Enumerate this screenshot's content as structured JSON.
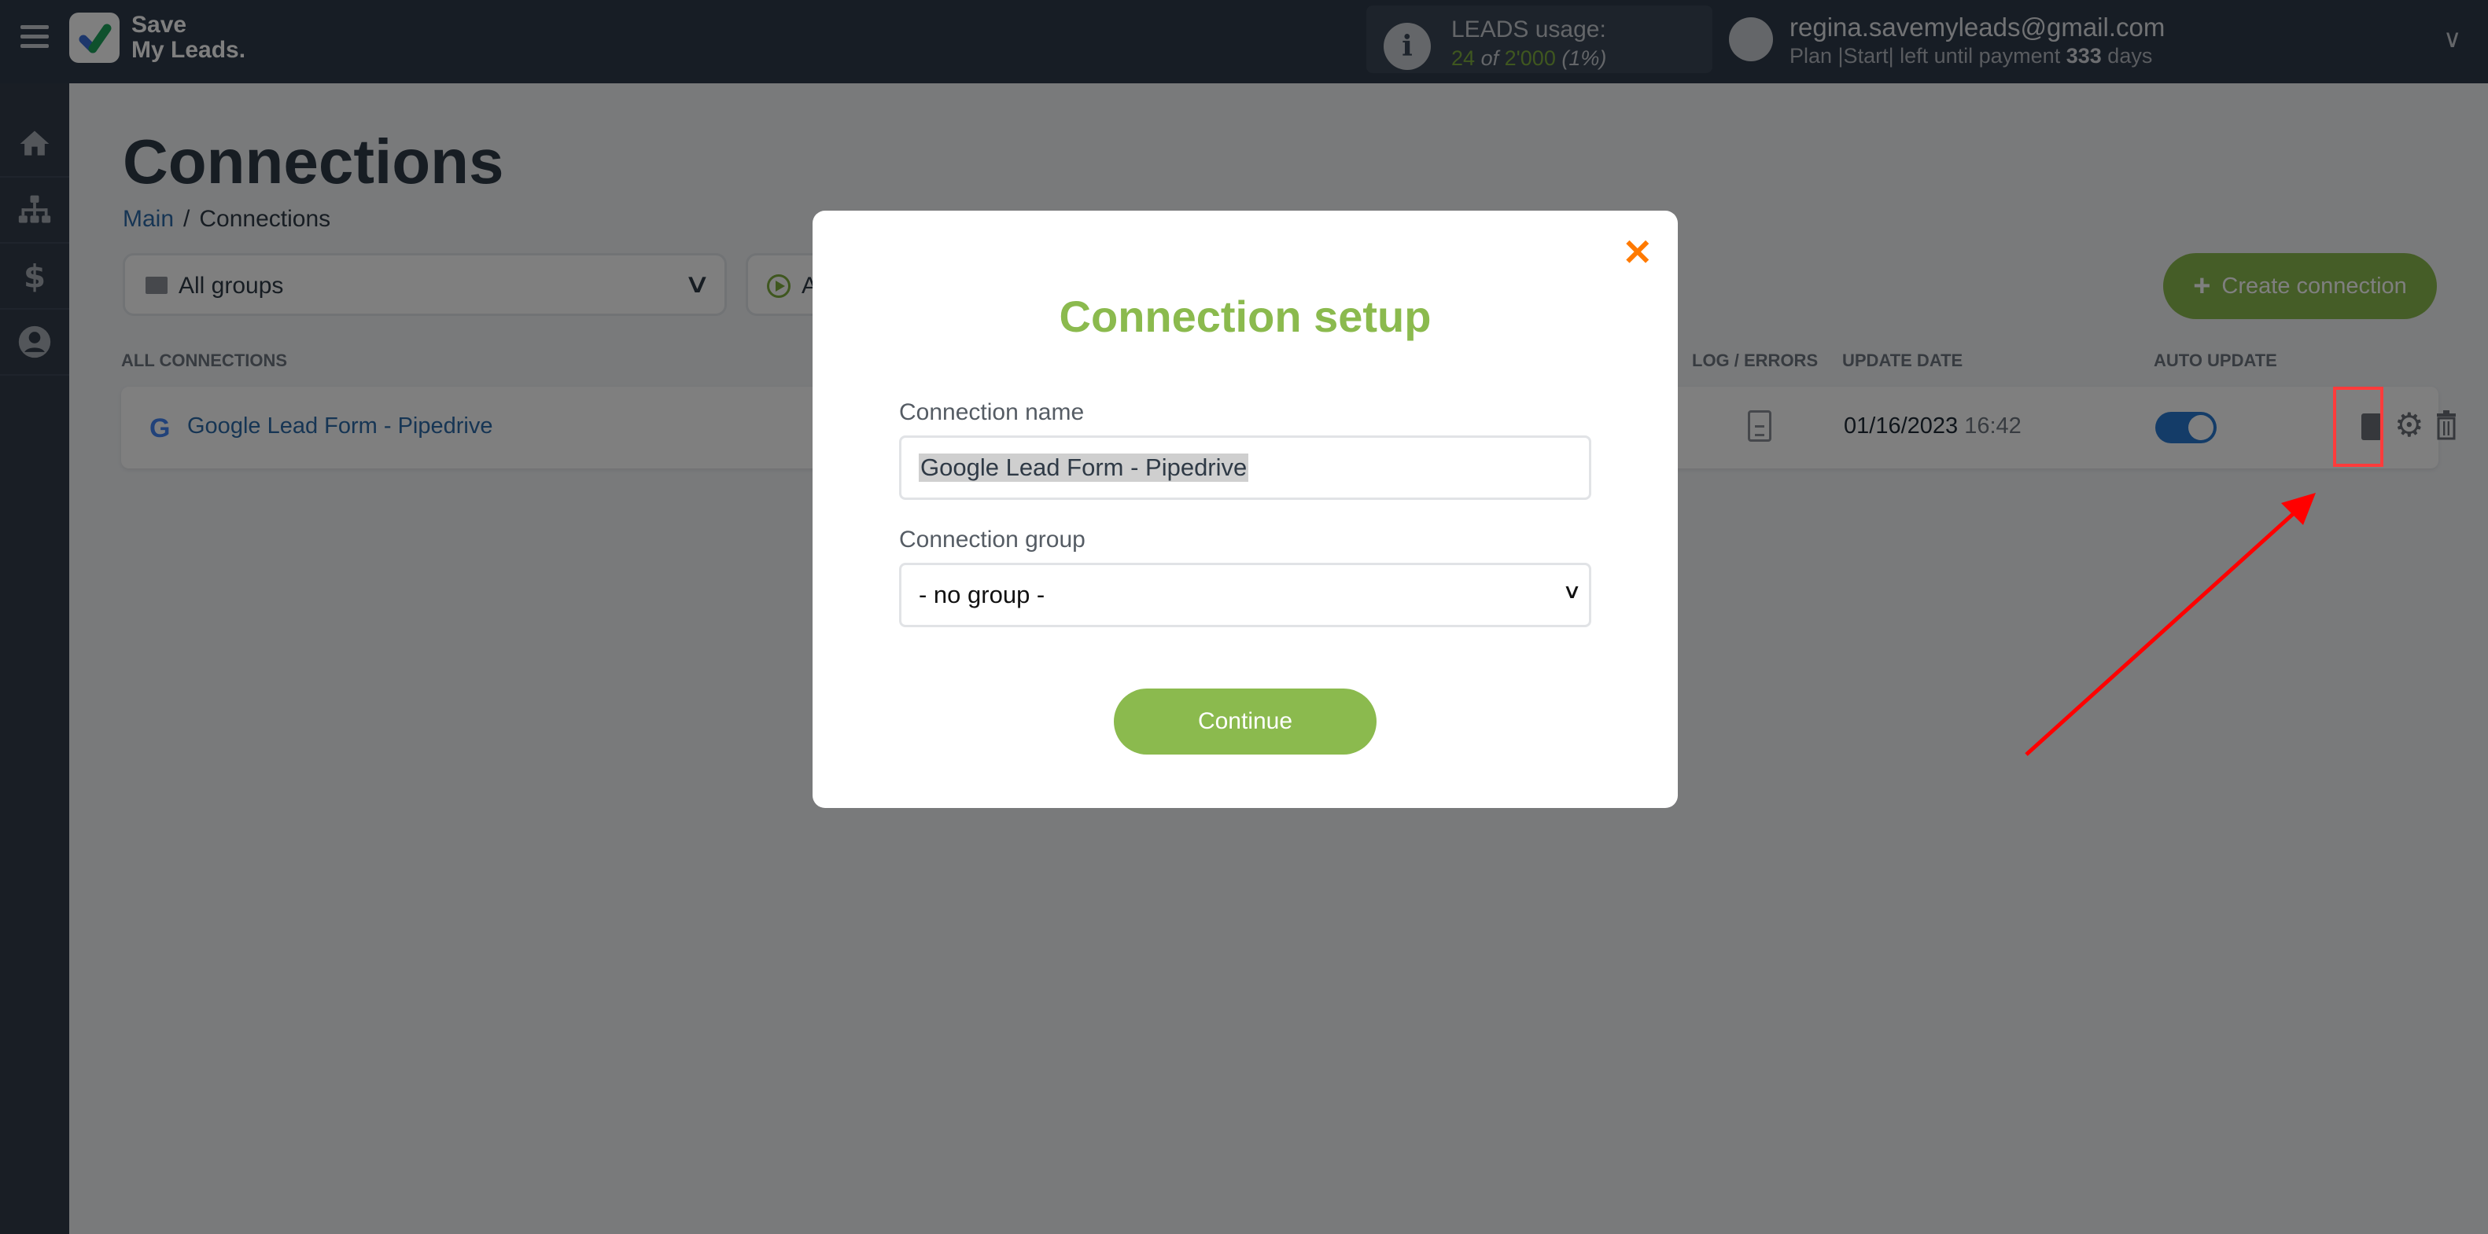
{
  "app": {
    "logo_line1": "Save",
    "logo_line2": "My Leads."
  },
  "topbar": {
    "usage_title": "LEADS usage:",
    "usage_used": "24",
    "usage_of": "of",
    "usage_total": "2'000",
    "usage_percent": "(1%)",
    "user_email": "regina.savemyleads@gmail.com",
    "plan_prefix": "Plan |Start| left until payment",
    "plan_days": "333",
    "plan_suffix": "days"
  },
  "sidebar": {
    "items": [
      {
        "name": "home",
        "icon": "home-icon"
      },
      {
        "name": "connections",
        "icon": "sitemap-icon"
      },
      {
        "name": "billing",
        "icon": "dollar-icon"
      },
      {
        "name": "account",
        "icon": "user-icon"
      }
    ]
  },
  "page": {
    "title": "Connections",
    "breadcrumb": {
      "root": "Main",
      "sep": "/",
      "current": "Connections"
    },
    "filter_groups": "All groups",
    "filter_status": "A",
    "create_button": "Create connection",
    "create_plus": "+"
  },
  "table": {
    "headers": {
      "all_connections": "ALL CONNECTIONS",
      "log_errors": "LOG / ERRORS",
      "update_date": "UPDATE DATE",
      "auto_update": "AUTO UPDATE"
    },
    "rows": [
      {
        "name": "Google Lead Form - Pipedrive",
        "source_icon": "G",
        "date": "01/16/2023",
        "time": "16:42",
        "auto_update": true
      }
    ]
  },
  "modal": {
    "close": "✕",
    "title": "Connection setup",
    "name_label": "Connection name",
    "name_value": "Google Lead Form - Pipedrive",
    "group_label": "Connection group",
    "group_value": "- no group -",
    "continue": "Continue"
  },
  "colors": {
    "accent_green": "#8bba4e",
    "close_orange": "#ff7a00",
    "link_blue": "#2c6aa8",
    "annotation_red": "#ff3b3b"
  }
}
